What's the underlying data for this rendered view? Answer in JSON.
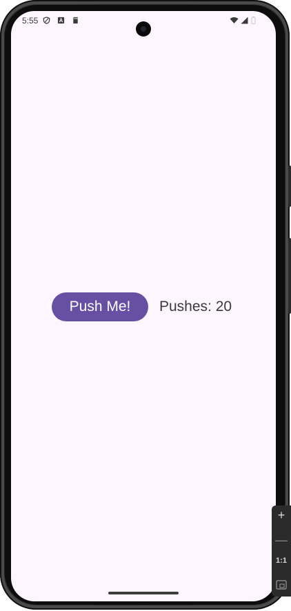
{
  "status_bar": {
    "time": "5:55",
    "left_icons": [
      "shield-icon",
      "a-badge-icon",
      "sd-card-icon"
    ],
    "right_icons": [
      "wifi-icon",
      "signal-icon",
      "battery-icon"
    ]
  },
  "main": {
    "button_label": "Push Me!",
    "counter_text": "Pushes: 20"
  },
  "emulator_toolbar": {
    "zoom_in": "+",
    "zoom_out": "—",
    "actual_size": "1:1"
  },
  "colors": {
    "button_background": "#6750a4",
    "screen_background": "#fdf6fe"
  }
}
